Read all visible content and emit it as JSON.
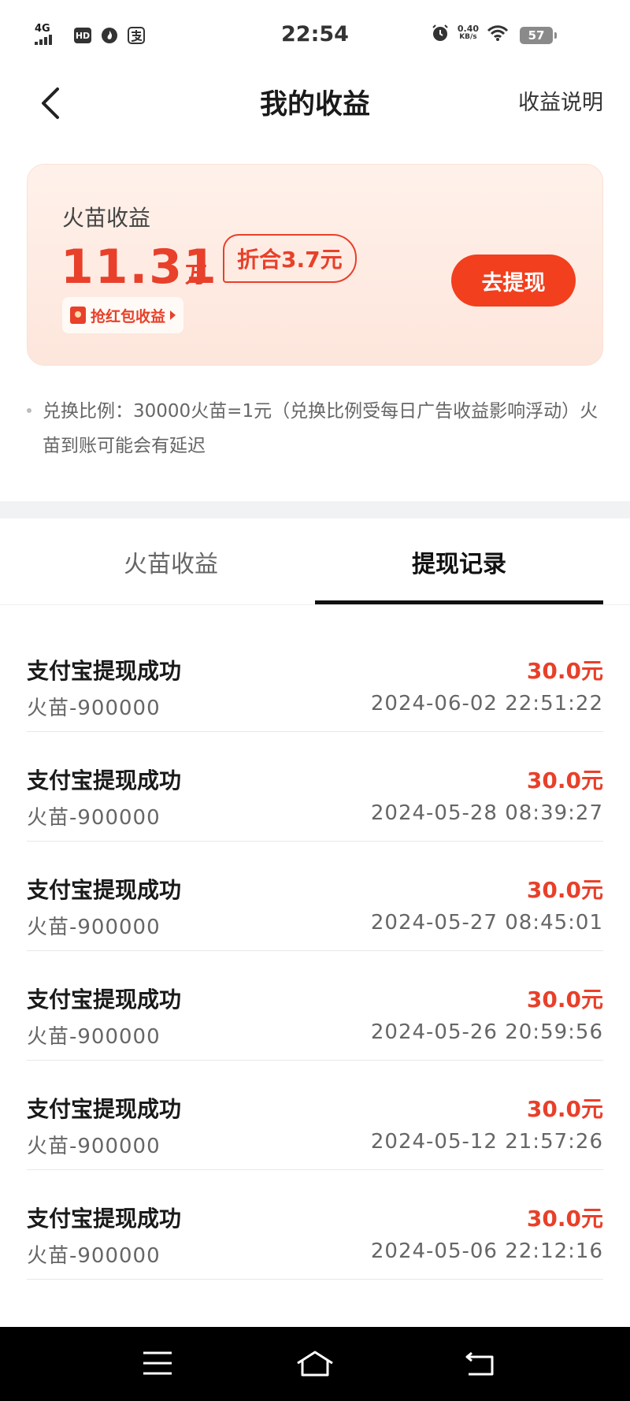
{
  "status_bar": {
    "network": "4G",
    "hd": "HD",
    "time": "22:54",
    "speed_value": "0.40",
    "speed_unit": "KB/s",
    "battery": "57"
  },
  "header": {
    "title": "我的收益",
    "help_link": "收益说明"
  },
  "card": {
    "label": "火苗收益",
    "amount": "11.31",
    "unit": "万",
    "equivalent": "折合3.7元",
    "tag": "抢红包收益",
    "withdraw_button": "去提现"
  },
  "note": "兑换比例：30000火苗=1元（兑换比例受每日广告收益影响浮动）火苗到账可能会有延迟",
  "tabs": [
    {
      "label": "火苗收益",
      "active": false
    },
    {
      "label": "提现记录",
      "active": true
    }
  ],
  "records": [
    {
      "title": "支付宝提现成功",
      "sub": "火苗-900000",
      "amount": "30.0元",
      "time": "2024-06-02 22:51:22"
    },
    {
      "title": "支付宝提现成功",
      "sub": "火苗-900000",
      "amount": "30.0元",
      "time": "2024-05-28 08:39:27"
    },
    {
      "title": "支付宝提现成功",
      "sub": "火苗-900000",
      "amount": "30.0元",
      "time": "2024-05-27 08:45:01"
    },
    {
      "title": "支付宝提现成功",
      "sub": "火苗-900000",
      "amount": "30.0元",
      "time": "2024-05-26 20:59:56"
    },
    {
      "title": "支付宝提现成功",
      "sub": "火苗-900000",
      "amount": "30.0元",
      "time": "2024-05-12 21:57:26"
    },
    {
      "title": "支付宝提现成功",
      "sub": "火苗-900000",
      "amount": "30.0元",
      "time": "2024-05-06 22:12:16"
    }
  ],
  "colors": {
    "accent": "#e8402a",
    "button": "#f23f1e",
    "card_bg": "#fde6dc"
  },
  "icons": [
    "back-chevron-icon",
    "red-envelope-icon",
    "menu-icon",
    "home-icon",
    "back-icon"
  ]
}
